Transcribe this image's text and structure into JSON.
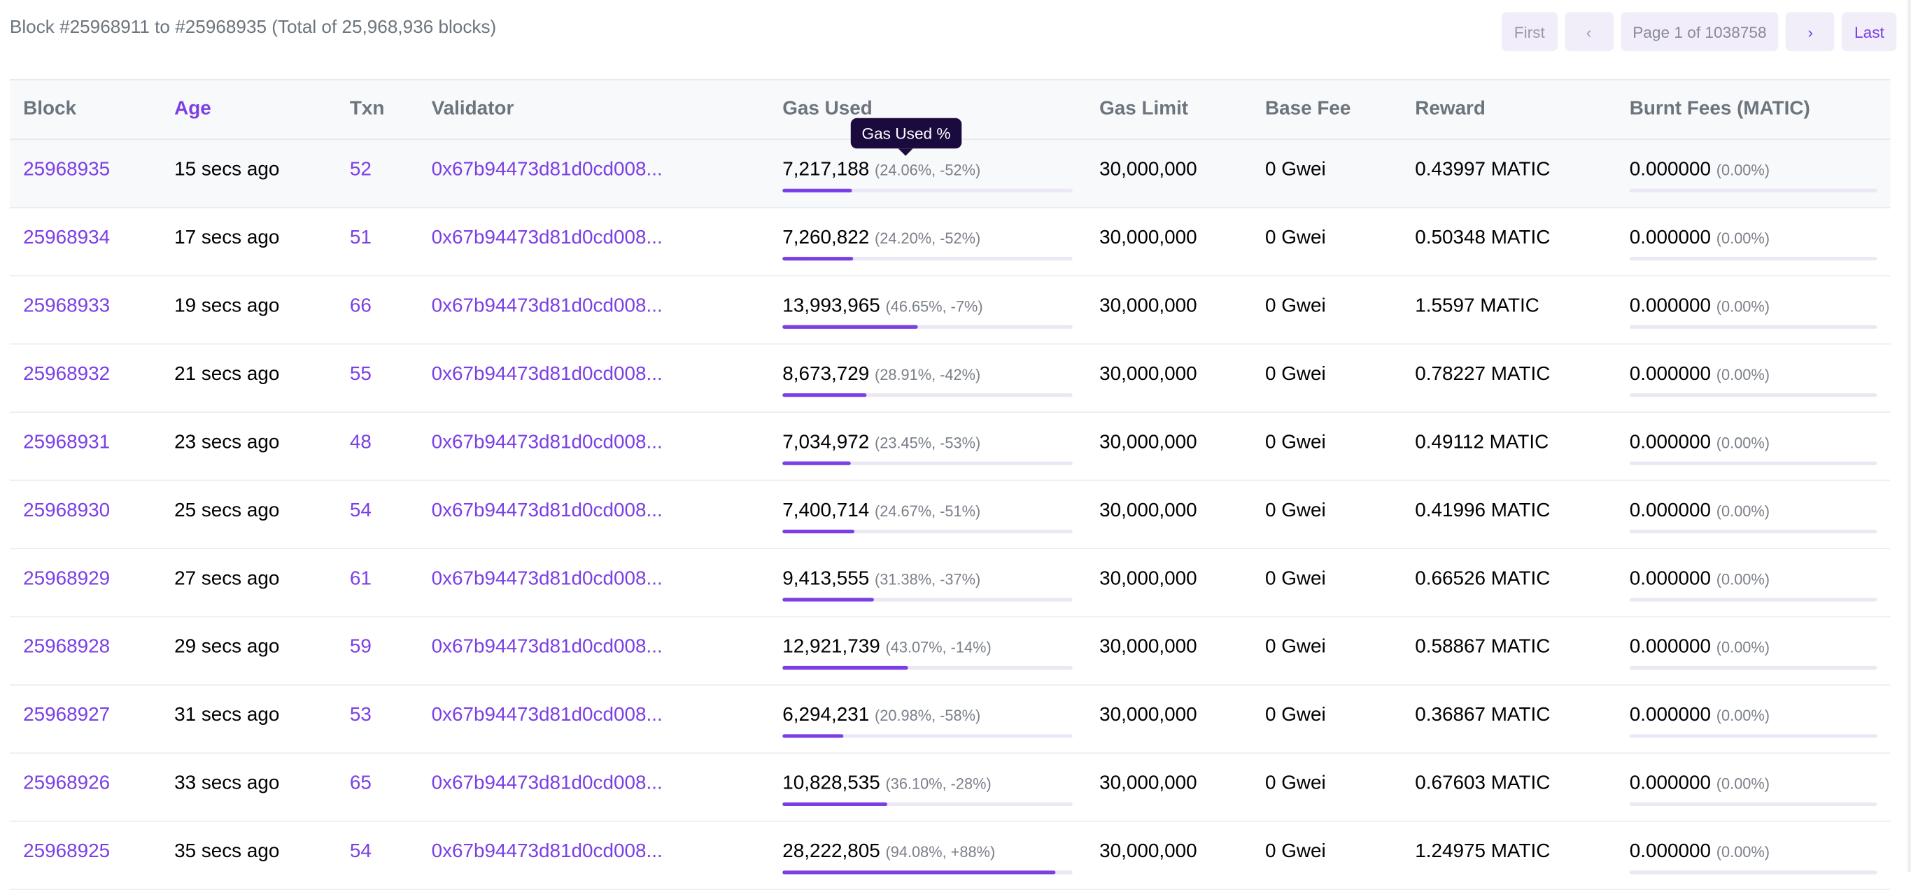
{
  "summary": "Block #25968911 to #25968935 (Total of 25,968,936 blocks)",
  "pagination": {
    "first": "First",
    "prev": "‹",
    "page": "Page 1 of 1038758",
    "next": "›",
    "last": "Last"
  },
  "columns": {
    "block": "Block",
    "age": "Age",
    "txn": "Txn",
    "validator": "Validator",
    "gas_used": "Gas Used",
    "gas_limit": "Gas Limit",
    "base_fee": "Base Fee",
    "reward": "Reward",
    "burnt_fees": "Burnt Fees (MATIC)"
  },
  "tooltip": "Gas Used %",
  "colors": {
    "accent": "#7b3fe4",
    "tooltip_bg": "#1b0a3d"
  },
  "rows": [
    {
      "block": "25968935",
      "age": "15 secs ago",
      "txn": "52",
      "validator": "0x67b94473d81d0cd008...",
      "gas_used": "7,217,188",
      "gas_detail": "(24.06%, -52%)",
      "gas_pct": 24.06,
      "gas_limit": "30,000,000",
      "base_fee": "0 Gwei",
      "reward": "0.43997 MATIC",
      "burnt": "0.000000",
      "burnt_pct": "(0.00%)"
    },
    {
      "block": "25968934",
      "age": "17 secs ago",
      "txn": "51",
      "validator": "0x67b94473d81d0cd008...",
      "gas_used": "7,260,822",
      "gas_detail": "(24.20%, -52%)",
      "gas_pct": 24.2,
      "gas_limit": "30,000,000",
      "base_fee": "0 Gwei",
      "reward": "0.50348 MATIC",
      "burnt": "0.000000",
      "burnt_pct": "(0.00%)"
    },
    {
      "block": "25968933",
      "age": "19 secs ago",
      "txn": "66",
      "validator": "0x67b94473d81d0cd008...",
      "gas_used": "13,993,965",
      "gas_detail": "(46.65%, -7%)",
      "gas_pct": 46.65,
      "gas_limit": "30,000,000",
      "base_fee": "0 Gwei",
      "reward": "1.5597 MATIC",
      "burnt": "0.000000",
      "burnt_pct": "(0.00%)"
    },
    {
      "block": "25968932",
      "age": "21 secs ago",
      "txn": "55",
      "validator": "0x67b94473d81d0cd008...",
      "gas_used": "8,673,729",
      "gas_detail": "(28.91%, -42%)",
      "gas_pct": 28.91,
      "gas_limit": "30,000,000",
      "base_fee": "0 Gwei",
      "reward": "0.78227 MATIC",
      "burnt": "0.000000",
      "burnt_pct": "(0.00%)"
    },
    {
      "block": "25968931",
      "age": "23 secs ago",
      "txn": "48",
      "validator": "0x67b94473d81d0cd008...",
      "gas_used": "7,034,972",
      "gas_detail": "(23.45%, -53%)",
      "gas_pct": 23.45,
      "gas_limit": "30,000,000",
      "base_fee": "0 Gwei",
      "reward": "0.49112 MATIC",
      "burnt": "0.000000",
      "burnt_pct": "(0.00%)"
    },
    {
      "block": "25968930",
      "age": "25 secs ago",
      "txn": "54",
      "validator": "0x67b94473d81d0cd008...",
      "gas_used": "7,400,714",
      "gas_detail": "(24.67%, -51%)",
      "gas_pct": 24.67,
      "gas_limit": "30,000,000",
      "base_fee": "0 Gwei",
      "reward": "0.41996 MATIC",
      "burnt": "0.000000",
      "burnt_pct": "(0.00%)"
    },
    {
      "block": "25968929",
      "age": "27 secs ago",
      "txn": "61",
      "validator": "0x67b94473d81d0cd008...",
      "gas_used": "9,413,555",
      "gas_detail": "(31.38%, -37%)",
      "gas_pct": 31.38,
      "gas_limit": "30,000,000",
      "base_fee": "0 Gwei",
      "reward": "0.66526 MATIC",
      "burnt": "0.000000",
      "burnt_pct": "(0.00%)"
    },
    {
      "block": "25968928",
      "age": "29 secs ago",
      "txn": "59",
      "validator": "0x67b94473d81d0cd008...",
      "gas_used": "12,921,739",
      "gas_detail": "(43.07%, -14%)",
      "gas_pct": 43.07,
      "gas_limit": "30,000,000",
      "base_fee": "0 Gwei",
      "reward": "0.58867 MATIC",
      "burnt": "0.000000",
      "burnt_pct": "(0.00%)"
    },
    {
      "block": "25968927",
      "age": "31 secs ago",
      "txn": "53",
      "validator": "0x67b94473d81d0cd008...",
      "gas_used": "6,294,231",
      "gas_detail": "(20.98%, -58%)",
      "gas_pct": 20.98,
      "gas_limit": "30,000,000",
      "base_fee": "0 Gwei",
      "reward": "0.36867 MATIC",
      "burnt": "0.000000",
      "burnt_pct": "(0.00%)"
    },
    {
      "block": "25968926",
      "age": "33 secs ago",
      "txn": "65",
      "validator": "0x67b94473d81d0cd008...",
      "gas_used": "10,828,535",
      "gas_detail": "(36.10%, -28%)",
      "gas_pct": 36.1,
      "gas_limit": "30,000,000",
      "base_fee": "0 Gwei",
      "reward": "0.67603 MATIC",
      "burnt": "0.000000",
      "burnt_pct": "(0.00%)"
    },
    {
      "block": "25968925",
      "age": "35 secs ago",
      "txn": "54",
      "validator": "0x67b94473d81d0cd008...",
      "gas_used": "28,222,805",
      "gas_detail": "(94.08%, +88%)",
      "gas_pct": 94.08,
      "gas_limit": "30,000,000",
      "base_fee": "0 Gwei",
      "reward": "1.24975 MATIC",
      "burnt": "0.000000",
      "burnt_pct": "(0.00%)"
    }
  ]
}
